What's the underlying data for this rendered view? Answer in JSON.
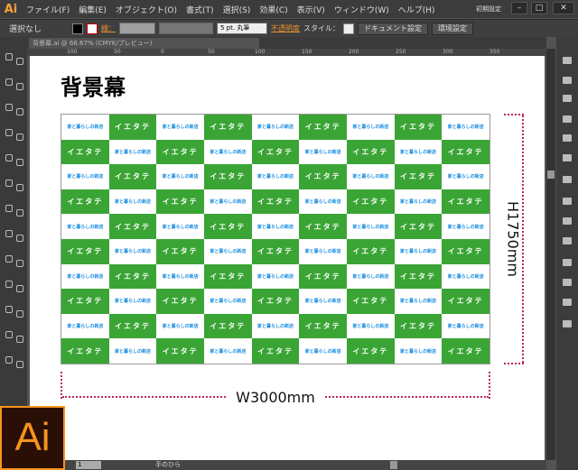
{
  "app": {
    "logo": "Ai",
    "workspace": "初期設定"
  },
  "menu": [
    "ファイル(F)",
    "編集(E)",
    "オブジェクト(O)",
    "書式(T)",
    "選択(S)",
    "効果(C)",
    "表示(V)",
    "ウィンドウ(W)",
    "ヘルプ(H)"
  ],
  "control": {
    "selection": "選択なし",
    "stroke_label": "線：",
    "brush": "5 pt. 丸筆",
    "opacity": "不透明度",
    "style": "スタイル：",
    "doc_settings": "ドキュメント設定",
    "prefs": "環境設定"
  },
  "tab": {
    "title": "背景幕.ai @ 66.67% (CMYK/プレビュー)"
  },
  "ruler": [
    "100",
    "50",
    "0",
    "50",
    "100",
    "150",
    "200",
    "250",
    "300",
    "350"
  ],
  "artboard": {
    "title": "背景幕",
    "green_text": "イエタテ",
    "white_text": "家と暮らしの新店",
    "width_label": "W3000mm",
    "height_label": "H1750mm",
    "columns": 9,
    "rows": 10,
    "colors": {
      "green": "#3aa535",
      "blue": "#1a8de0",
      "dim": "#c0285a"
    }
  },
  "status": {
    "page": "1",
    "tool": "手のひら"
  }
}
